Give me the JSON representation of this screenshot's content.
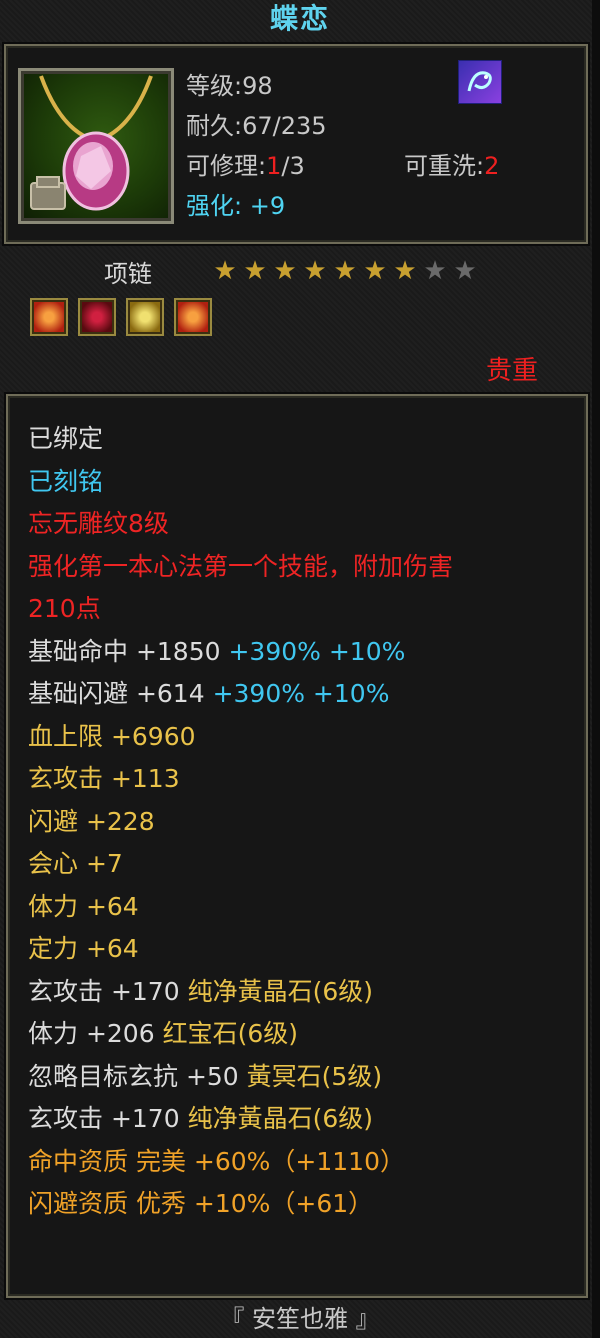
{
  "title": "蝶恋",
  "header": {
    "level": "等级:98",
    "durability": "耐久:67/235",
    "repair_label": "可修理:",
    "repair_used": "1",
    "repair_total": "/3",
    "rewash_label": "可重洗:",
    "rewash_value": "2",
    "enhance": "强化: +9",
    "badge_icon": "dragon-emblem-icon"
  },
  "item_type": "项链",
  "stars": {
    "filled": 7,
    "total": 9
  },
  "gem_slots": [
    "red-orange-gem-icon",
    "red-gem-icon",
    "yellow-gem-icon",
    "red-orange-gem-icon"
  ],
  "rarity": "贵重",
  "lines": [
    {
      "text": "已绑定",
      "color": "white"
    },
    {
      "text": "已刻铭",
      "color": "cyan"
    },
    {
      "text": "忘无雕纹8级",
      "color": "red"
    },
    {
      "text": "强化第一本心法第一个技能，附加伤害",
      "color": "red"
    },
    {
      "text": "210点",
      "color": "red"
    },
    {
      "parts": [
        {
          "text": "基础命中 +1850 ",
          "color": "white"
        },
        {
          "text": "+390% +10%",
          "color": "cyan"
        }
      ]
    },
    {
      "parts": [
        {
          "text": "基础闪避 +614 ",
          "color": "white"
        },
        {
          "text": "+390% +10%",
          "color": "cyan"
        }
      ]
    },
    {
      "text": "血上限 +6960",
      "color": "gold"
    },
    {
      "text": "玄攻击 +113",
      "color": "gold"
    },
    {
      "text": "闪避 +228",
      "color": "gold"
    },
    {
      "text": "会心 +7",
      "color": "gold"
    },
    {
      "text": "体力 +64",
      "color": "gold"
    },
    {
      "text": "定力 +64",
      "color": "gold"
    },
    {
      "parts": [
        {
          "text": "玄攻击 +170 ",
          "color": "white"
        },
        {
          "text": "纯净黃晶石(6级)",
          "color": "gold"
        }
      ]
    },
    {
      "parts": [
        {
          "text": "体力 +206 ",
          "color": "white"
        },
        {
          "text": "红宝石(6级)",
          "color": "gold"
        }
      ]
    },
    {
      "parts": [
        {
          "text": "忽略目标玄抗 +50 ",
          "color": "white"
        },
        {
          "text": "黃冥石(5级)",
          "color": "gold"
        }
      ]
    },
    {
      "parts": [
        {
          "text": "玄攻击 +170 ",
          "color": "white"
        },
        {
          "text": "纯净黃晶石(6级)",
          "color": "gold"
        }
      ]
    },
    {
      "text": "命中资质  完美 +60%（+1110）",
      "color": "orange"
    },
    {
      "text": "闪避资质  优秀 +10%（+61）",
      "color": "orange"
    }
  ],
  "footer": "『 安笙也雅 』"
}
